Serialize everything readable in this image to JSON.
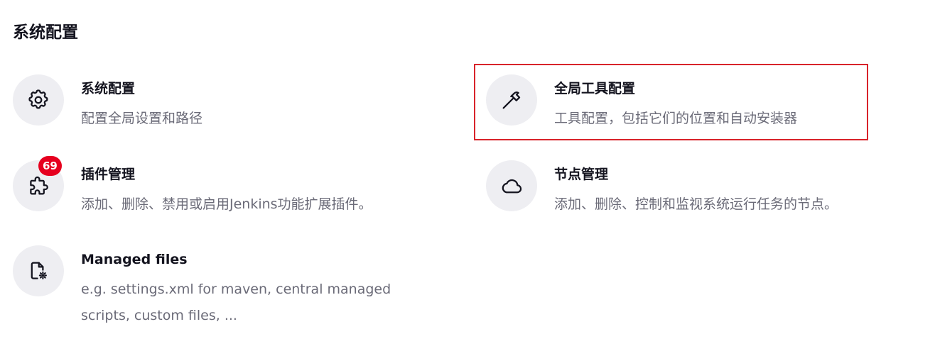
{
  "page": {
    "section_title": "系统配置"
  },
  "cards": {
    "system": {
      "title": "系统配置",
      "description": "配置全局设置和路径",
      "icon": "gear-icon"
    },
    "tools": {
      "title": "全局工具配置",
      "description": "工具配置，包括它们的位置和自动安装器",
      "icon": "hammer-icon"
    },
    "plugins": {
      "title": "插件管理",
      "description": "添加、删除、禁用或启用Jenkins功能扩展插件。",
      "icon": "puzzle-icon",
      "badge": "69"
    },
    "nodes": {
      "title": "节点管理",
      "description": "添加、删除、控制和监视系统运行任务的节点。",
      "icon": "cloud-icon"
    },
    "managed_files": {
      "title": "Managed files",
      "description": "e.g. settings.xml for maven, central managed scripts, custom files, ...",
      "icon": "file-gear-icon"
    }
  },
  "colors": {
    "badge": "#e6001f",
    "highlight_border": "#d8232a",
    "icon_background": "#eeeef2",
    "description_text": "#6b6b78"
  }
}
